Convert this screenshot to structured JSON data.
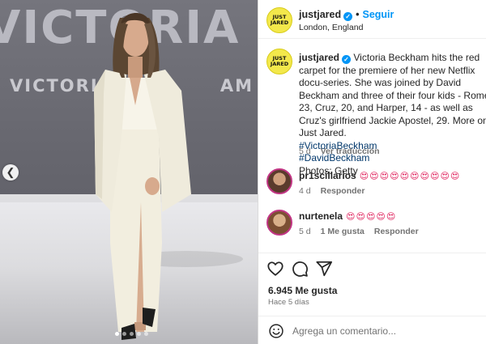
{
  "photo": {
    "backdrop_big_text": "VICTORIA",
    "backdrop_small_text_left": "VICTORIA",
    "backdrop_small_text_right": "AM",
    "prev_icon": "chevron-left-icon",
    "carousel_dots": 5,
    "active_dot": 1
  },
  "header": {
    "avatar_text_line1": "JUST",
    "avatar_text_line2": "JARED",
    "username": "justjared",
    "separator": "•",
    "follow_label": "Seguir",
    "location": "London, England"
  },
  "caption": {
    "username": "justjared",
    "text": "Victoria Beckham hits the red carpet for the premiere of her new Netflix docu-series. She was joined by David Beckham and three of their four kids - Romeo, 23, Cruz, 20, and Harper, 14 - as well as Cruz's girlfriend Jackie Apostel, 29. More on Just Jared.",
    "hashtags": [
      "#VictoriaBeckham",
      "#DavidBeckham"
    ],
    "credit": "Photos: Getty",
    "time": "5 d",
    "translate_label": "Ver traducción"
  },
  "comments": [
    {
      "username": "pr1scillarios",
      "text": "😍😍😍😍😍😍😍😍😍😍",
      "time": "4 d",
      "reply_label": "Responder"
    },
    {
      "username": "nurtenela",
      "text": "😍😍😍😍😍",
      "time": "5 d",
      "likes_label": "1 Me gusta",
      "reply_label": "Responder"
    }
  ],
  "actions": {
    "like_icon": "heart-icon",
    "comment_icon": "comment-icon",
    "share_icon": "share-icon",
    "likes": "6.945 Me gusta",
    "ago": "Hace 5 días"
  },
  "add_comment": {
    "emoji_icon": "smile-icon",
    "placeholder": "Agrega un comentario..."
  },
  "colors": {
    "link": "#00376b",
    "follow": "#0095f6",
    "secondary": "#737373",
    "emoji": "#e0245e"
  }
}
